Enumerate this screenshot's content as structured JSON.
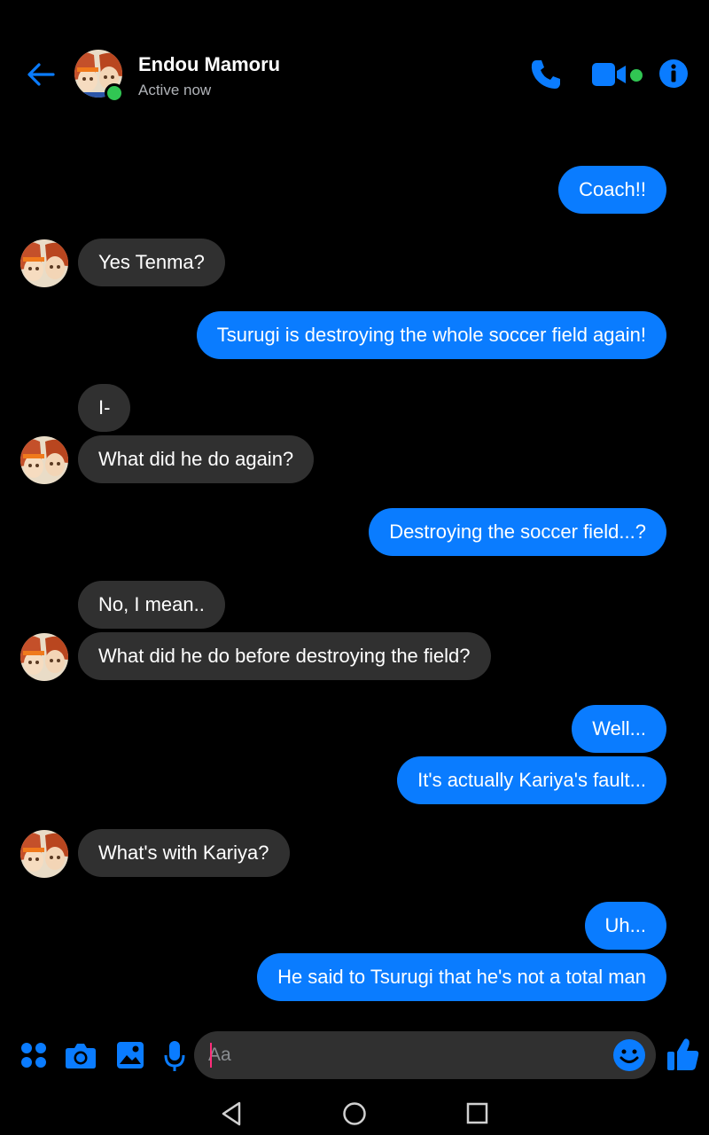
{
  "header": {
    "contact_name": "Endou Mamoru",
    "status": "Active now",
    "icons": {
      "back": "back-arrow-icon",
      "call": "phone-icon",
      "video": "video-camera-icon",
      "info": "info-icon"
    }
  },
  "colors": {
    "accent": "#0a7cff",
    "sent_bubble": "#0a7cff",
    "received_bubble": "#303030",
    "online": "#31c653",
    "background": "#000000",
    "caret": "#ff2d7a"
  },
  "messages": [
    {
      "from": "me",
      "text": "Coach!!"
    },
    {
      "from": "contact",
      "text": "Yes Tenma?"
    },
    {
      "from": "me",
      "text": "Tsurugi is destroying the whole soccer field again!"
    },
    {
      "from": "contact",
      "text": "I-"
    },
    {
      "from": "contact",
      "text": "What did he do again?"
    },
    {
      "from": "me",
      "text": "Destroying the soccer field...?"
    },
    {
      "from": "contact",
      "text": "No, I mean.."
    },
    {
      "from": "contact",
      "text": "What did he do before destroying the field?"
    },
    {
      "from": "me",
      "text": "Well..."
    },
    {
      "from": "me",
      "text": "It's actually Kariya's fault..."
    },
    {
      "from": "contact",
      "text": "What's with Kariya?"
    },
    {
      "from": "me",
      "text": "Uh..."
    },
    {
      "from": "me",
      "text": "He said to Tsurugi that he's not a total man"
    }
  ],
  "composer": {
    "placeholder": "Aa",
    "icons": [
      "apps-icon",
      "camera-icon",
      "gallery-icon",
      "microphone-icon",
      "emoji-icon",
      "thumbs-up-icon"
    ]
  },
  "navbar": {
    "icons": [
      "nav-back-icon",
      "nav-home-icon",
      "nav-recents-icon"
    ]
  }
}
